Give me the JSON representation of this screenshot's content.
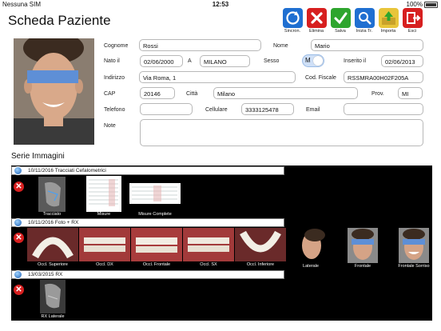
{
  "status": {
    "carrier": "Nessuna SIM",
    "time": "12:53",
    "battery": "100%"
  },
  "title": "Scheda Paziente",
  "toolbar": [
    {
      "label": "Sincron.",
      "icon": "sync-icon",
      "color": "#1f6fd1"
    },
    {
      "label": "Elimina",
      "icon": "delete-icon",
      "color": "#d71f1f"
    },
    {
      "label": "Salva",
      "icon": "save-icon",
      "color": "#2ea52e"
    },
    {
      "label": "Inizia Tr.",
      "icon": "start-tracing-icon",
      "color": "#1f6fd1"
    },
    {
      "label": "Importa",
      "icon": "import-icon",
      "color": "#e8c53a"
    },
    {
      "label": "Esci",
      "icon": "exit-icon",
      "color": "#d71f1f"
    }
  ],
  "form": {
    "cognome_label": "Cognome",
    "cognome": "Rossi",
    "nome_label": "Nome",
    "nome": "Mario",
    "nato_label": "Nato il",
    "nato": "02/06/2000",
    "a_label": "A",
    "luogo": "MILANO",
    "sesso_label": "Sesso",
    "sesso": "M",
    "inserito_label": "Inserito il",
    "inserito": "02/06/2013",
    "indirizzo_label": "Indirizzo",
    "indirizzo": "Via Roma, 1",
    "cf_label": "Cod. Fiscale",
    "cf": "RSSMRA00H02F205A",
    "cap_label": "CAP",
    "cap": "20146",
    "citta_label": "Città",
    "citta": "Milano",
    "prov_label": "Prov.",
    "prov": "MI",
    "telefono_label": "Telefono",
    "telefono": "",
    "cellulare_label": "Cellulare",
    "cellulare": "3333125478",
    "email_label": "Email",
    "email": "",
    "note_label": "Note",
    "note": ""
  },
  "serie_title": "Serie Immagini",
  "series": [
    {
      "header": "10/11/2016 Tracciati Cefalometrici",
      "items": [
        "Tracciato",
        "Misure",
        "Misure Complete"
      ]
    },
    {
      "header": "10/11/2016 Foto + RX",
      "items": [
        "Occl. Superiore",
        "Occl. DX",
        "Occl. Frontale",
        "Occl. SX",
        "Occl. Inferiore",
        "Laterale",
        "Frontale",
        "Frontale Sorriso"
      ]
    },
    {
      "header": "13/03/2015 RX",
      "items": [
        "RX Laterale"
      ]
    }
  ]
}
